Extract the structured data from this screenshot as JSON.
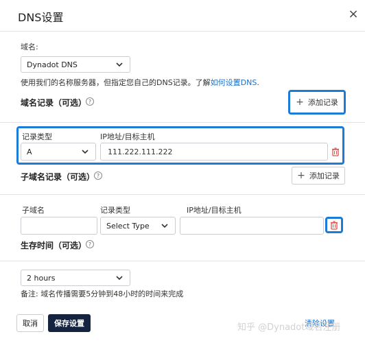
{
  "header": {
    "title": "DNS设置",
    "close_label": "×"
  },
  "domain_section": {
    "label": "域名:",
    "select_value": "Dynadot DNS",
    "note_prefix": "使用我们的名称服务器，但指定您自己的DNS记录。了解",
    "note_link": "如何设置DNS",
    "note_suffix": "."
  },
  "domain_records": {
    "heading": "域名记录（可选）",
    "help": "?",
    "add_button": "添加记录",
    "record_type_label": "记录类型",
    "ip_label": "IP地址/目标主机",
    "record_type_value": "A",
    "ip_value": "111.222.111.222"
  },
  "subdomain_records": {
    "heading": "子域名记录（可选）",
    "help": "?",
    "add_button": "添加记录",
    "subdomain_label": "子域名",
    "record_type_label": "记录类型",
    "ip_label": "IP地址/目标主机",
    "subdomain_value": "",
    "record_type_value": "Select Type",
    "ip_value": ""
  },
  "ttl": {
    "heading": "生存时间（可选）",
    "help": "?",
    "select_value": "2 hours",
    "note": "备注: 域名传播需要5分钟到48小时的时间来完成"
  },
  "footer": {
    "cancel": "取消",
    "save": "保存设置",
    "clear": "清除设置"
  },
  "watermark": "知乎 @Dynadot域名注册",
  "colors": {
    "highlight": "#1a7cd6",
    "save_bg": "#14233f",
    "trash": "#d9534f",
    "link": "#1a6fc5"
  }
}
